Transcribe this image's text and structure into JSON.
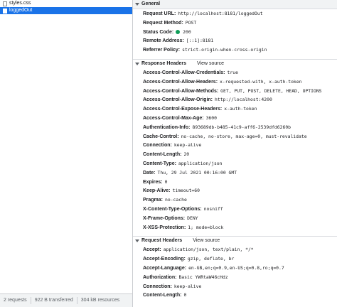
{
  "requests": [
    "styles.css",
    "loggedOut"
  ],
  "status_bar": {
    "requests": "2 requests",
    "transferred": "922 B transferred",
    "resources": "304 kB resources"
  },
  "general": {
    "title": "General",
    "url_k": "Request URL:",
    "url_v": "http://localhost:8181/loggedOut",
    "method_k": "Request Method:",
    "method_v": "POST",
    "status_k": "Status Code:",
    "status_v": "200",
    "remote_k": "Remote Address:",
    "remote_v": "[::1]:8181",
    "referrer_k": "Referrer Policy:",
    "referrer_v": "strict-origin-when-cross-origin",
    "status_color": "#0f9d58"
  },
  "response": {
    "title": "Response Headers",
    "view_source": "View source",
    "rows": [
      {
        "k": "Access-Control-Allow-Credentials:",
        "v": "true"
      },
      {
        "k": "Access-Control-Allow-Headers:",
        "v": "x-requested-with, x-auth-token"
      },
      {
        "k": "Access-Control-Allow-Methods:",
        "v": "GET, PUT, POST, DELETE, HEAD, OPTIONS"
      },
      {
        "k": "Access-Control-Allow-Origin:",
        "v": "http://localhost:4200"
      },
      {
        "k": "Access-Control-Expose-Headers:",
        "v": "x-auth-token"
      },
      {
        "k": "Access-Control-Max-Age:",
        "v": "3600"
      },
      {
        "k": "Authentication-Info:",
        "v": "893689db-b485-41c9-aff6-2539dfd6260b"
      },
      {
        "k": "Cache-Control:",
        "v": "no-cache, no-store, max-age=0, must-revalidate"
      },
      {
        "k": "Connection:",
        "v": "keep-alive"
      },
      {
        "k": "Content-Length:",
        "v": "20"
      },
      {
        "k": "Content-Type:",
        "v": "application/json"
      },
      {
        "k": "Date:",
        "v": "Thu, 29 Jul 2021 00:16:00 GMT"
      },
      {
        "k": "Expires:",
        "v": "0"
      },
      {
        "k": "Keep-Alive:",
        "v": "timeout=60"
      },
      {
        "k": "Pragma:",
        "v": "no-cache"
      },
      {
        "k": "X-Content-Type-Options:",
        "v": "nosniff"
      },
      {
        "k": "X-Frame-Options:",
        "v": "DENY"
      },
      {
        "k": "X-XSS-Protection:",
        "v": "1; mode=block"
      }
    ]
  },
  "request": {
    "title": "Request Headers",
    "view_source": "View source",
    "rows": [
      {
        "k": "Accept:",
        "v": "application/json, text/plain, */*"
      },
      {
        "k": "Accept-Encoding:",
        "v": "gzip, deflate, br"
      },
      {
        "k": "Accept-Language:",
        "v": "en-GB,en;q=0.9,en-US;q=0.8,ro;q=0.7"
      },
      {
        "k": "Authorization:",
        "v": "Basic YWRtaW46cHdz"
      },
      {
        "k": "Connection:",
        "v": "keep-alive"
      },
      {
        "k": "Content-Length:",
        "v": "0"
      }
    ]
  }
}
